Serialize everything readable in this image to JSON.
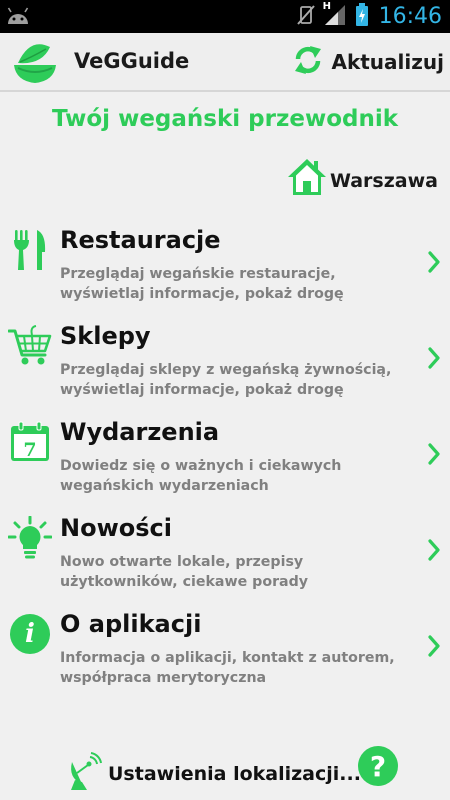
{
  "status_bar": {
    "time": "16:46",
    "network_type": "H"
  },
  "app_bar": {
    "title": "VeGGuide",
    "refresh_label": "Aktualizuj"
  },
  "main": {
    "heading": "Twój wegański przewodnik",
    "city": "Warszawa"
  },
  "menu": [
    {
      "icon": "fork-knife-icon",
      "title": "Restauracje",
      "description": "Przeglądaj wegańskie restauracje, wyświetlaj informacje, pokaż drogę"
    },
    {
      "icon": "shopping-cart-icon",
      "title": "Sklepy",
      "description": "Przeglądaj sklepy z wegańską żywnością, wyświetlaj informacje, pokaż drogę"
    },
    {
      "icon": "calendar-icon",
      "title": "Wydarzenia",
      "description": "Dowiedz się o ważnych i ciekawych wegańskich wydarzeniach",
      "calendar_day": "7"
    },
    {
      "icon": "lightbulb-icon",
      "title": "Nowości",
      "description": "Nowo otwarte lokale, przepisy użytkowników, ciekawe porady"
    },
    {
      "icon": "info-icon",
      "title": "O aplikacji",
      "description": "Informacja o aplikacji, kontakt z autorem, współpraca merytoryczna",
      "info_glyph": "i"
    }
  ],
  "footer": {
    "location_settings_label": "Ustawienia lokalizacji...",
    "help_glyph": "?"
  },
  "colors": {
    "accent": "#2ecc59",
    "description_text": "#808080",
    "status_clock": "#33b5e5"
  }
}
